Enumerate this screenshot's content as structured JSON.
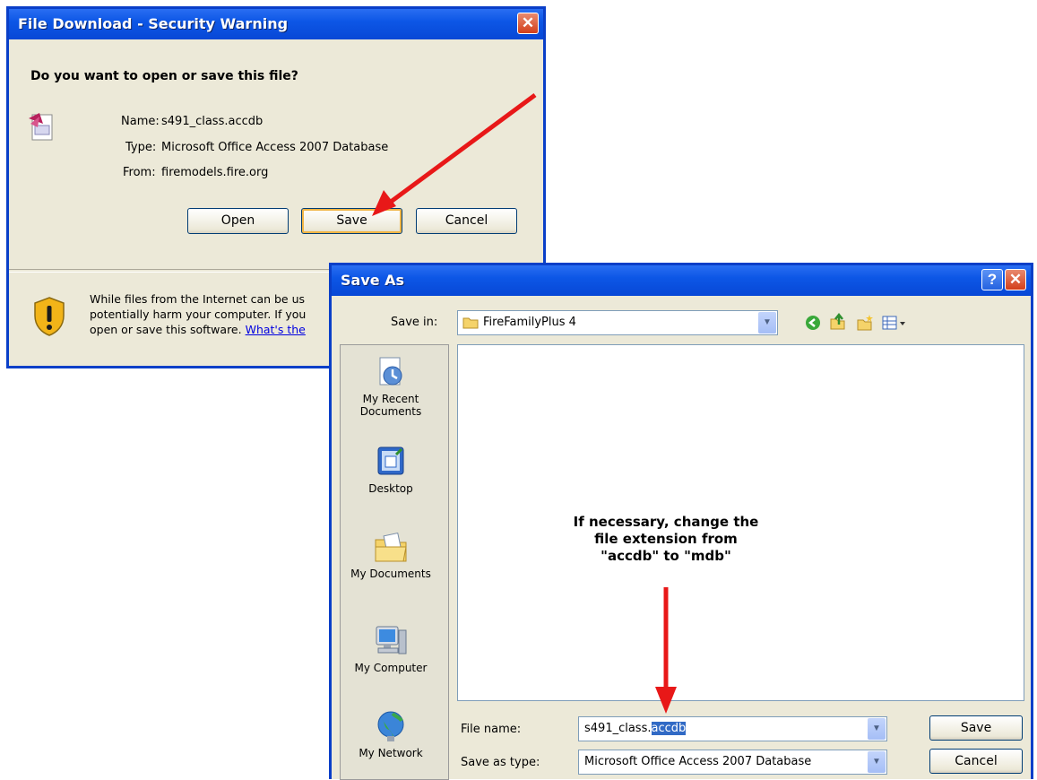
{
  "download_dialog": {
    "title": "File Download - Security Warning",
    "question": "Do you want to open or save this file?",
    "name_label": "Name:",
    "name_value": "s491_class.accdb",
    "type_label": "Type:",
    "type_value": "Microsoft Office Access 2007 Database",
    "from_label": "From:",
    "from_value": "firemodels.fire.org",
    "buttons": {
      "open": "Open",
      "save": "Save",
      "cancel": "Cancel"
    },
    "warning_line1": "While files from the Internet can be us",
    "warning_line2": "potentially harm your computer. If you",
    "warning_line3": "open or save this software.",
    "warning_link": "What's the"
  },
  "save_dialog": {
    "title": "Save As",
    "save_in_label": "Save in:",
    "save_in_value": "FireFamilyPlus 4",
    "places": [
      {
        "line1": "My Recent",
        "line2": "Documents"
      },
      {
        "line1": "Desktop",
        "line2": ""
      },
      {
        "line1": "My Documents",
        "line2": ""
      },
      {
        "line1": "My Computer",
        "line2": ""
      },
      {
        "line1": "My Network",
        "line2": ""
      }
    ],
    "file_name_label": "File name:",
    "file_name_base": "s491_class.",
    "file_name_selected": "accdb",
    "save_as_type_label": "Save as type:",
    "save_as_type_value": "Microsoft Office Access 2007 Database",
    "buttons": {
      "save": "Save",
      "cancel": "Cancel"
    }
  },
  "annotation": {
    "line1": "If necessary, change the",
    "line2": "file extension from",
    "line3": "\"accdb\" to \"mdb\""
  },
  "colors": {
    "title_blue": "#0d57e6",
    "arrow_red": "#e81818",
    "selection": "#316ac5"
  }
}
